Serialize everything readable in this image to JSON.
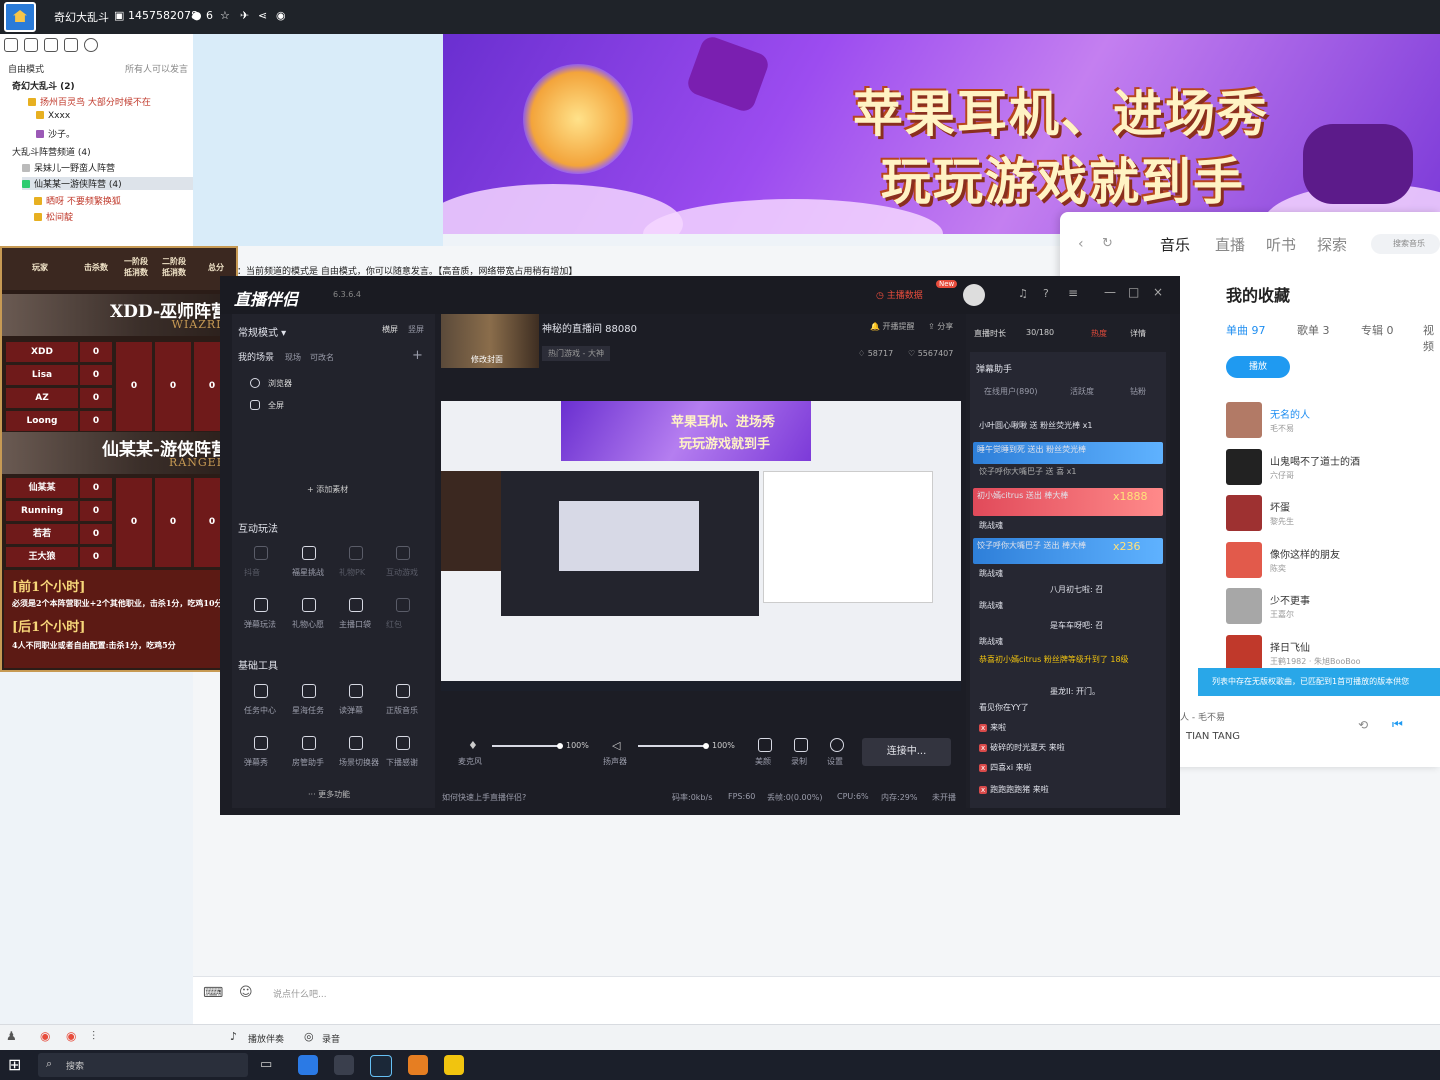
{
  "topbar": {
    "channel_name": "奇幻大乱斗",
    "channel_id": "1457582078",
    "user_count": "6"
  },
  "left_panel": {
    "mode_label": "自由模式",
    "mode_hint": "所有人可以发言",
    "tree": [
      {
        "text": "奇幻大乱斗 (2)"
      },
      {
        "text": "扬州百灵鸟 大部分时候不在"
      },
      {
        "text": "Xxxx"
      },
      {
        "text": "沙子。"
      },
      {
        "text": "大乱斗阵营频道 (4)"
      },
      {
        "text": "呆妹儿一野蛮人阵营"
      },
      {
        "text": "仙某某一游侠阵营 (4)"
      },
      {
        "text": "晒呀 不要频繁换狐"
      },
      {
        "text": "松间靛"
      }
    ]
  },
  "notice": "：当前频道的模式是 自由模式，你可以随意发言。【高音质，网络带宽占用稍有增加】",
  "banner": {
    "line1": "苹果耳机、进场秀",
    "line2": "玩玩游戏就到手"
  },
  "scoreboard": {
    "headers": [
      "玩家",
      "击杀数",
      "一阶段 抵消数",
      "二阶段 抵消数",
      "总分"
    ],
    "team1": {
      "name": "XDD-巫师阵营",
      "sub": "WIAZRD",
      "players": [
        {
          "name": "XDD",
          "kills": "0"
        },
        {
          "name": "Lisa",
          "kills": "0"
        },
        {
          "name": "AZ",
          "kills": "0"
        },
        {
          "name": "Loong",
          "kills": "0"
        }
      ],
      "totals": [
        "0",
        "0",
        "0"
      ]
    },
    "team2": {
      "name": "仙某某-游侠阵营",
      "sub": "RANGER",
      "players": [
        {
          "name": "仙某某",
          "kills": "0"
        },
        {
          "name": "Running",
          "kills": "0"
        },
        {
          "name": "若若",
          "kills": "0"
        },
        {
          "name": "王大狼",
          "kills": "0"
        }
      ],
      "totals": [
        "0",
        "0",
        "0"
      ]
    },
    "rules": {
      "t1": "[前1个小时]",
      "r1": "必须是2个本阵营职业+2个其他职业，击杀1分，吃鸡10分",
      "t2": "[后1个小时]",
      "r2": "4人不同职业或者自由配置:击杀1分，吃鸡5分"
    }
  },
  "app": {
    "logo": "直播伴侣",
    "version": "6.3.6.4",
    "live_data": "主播数据",
    "new_badge": "New",
    "mode": "常规模式",
    "orientation": [
      "横屏",
      "竖屏"
    ],
    "scene_label": "我的场景",
    "scene_tabs": [
      "现场",
      "可改名"
    ],
    "sources": [
      "浏览器",
      "全屏"
    ],
    "add_material": "+ 添加素材",
    "interactive": "互动玩法",
    "interactive_items": [
      "抖音",
      "福星挑战",
      "礼物PK",
      "互动游戏",
      "弹幕玩法",
      "礼物心愿",
      "主播口袋",
      "红包"
    ],
    "tools": "基础工具",
    "tools_items": [
      "任务中心",
      "星海任务",
      "读弹幕",
      "正版音乐",
      "弹幕秀",
      "房管助手",
      "场景切换器",
      "下播感谢"
    ],
    "more": "··· 更多功能",
    "room_title": "神秘的直播间 88080",
    "category": "热门游戏 - 大神",
    "cover_label": "修改封面",
    "open_remind": "开播提醒",
    "share": "分享",
    "fans": "58717",
    "likes": "5567407",
    "duration_label": "直播时长",
    "duration_value": "30/180",
    "heat": "热度",
    "details": "详情",
    "mic_label": "麦克风",
    "mic_pct": "100%",
    "spk_label": "扬声器",
    "spk_pct": "100%",
    "beauty": "美颜",
    "record": "录制",
    "settings": "设置",
    "connect": "连接中...",
    "hint": "如何快速上手直播伴侣?",
    "stats": [
      "码率:0kb/s",
      "FPS:60",
      "丢帧:0(0.00%)",
      "CPU:6%",
      "内存:29%",
      "未开播"
    ],
    "danmu_title": "弹幕助手",
    "danmu_tabs": [
      "在线用户(890)",
      "活跃度",
      "钻粉"
    ],
    "chat": [
      "小叶圆心啾啾 送 粉丝荧光棒 x1",
      "睡午觉睡到死 送出 粉丝荧光棒",
      "饺子呼你大嘴巴子 送 喜 x1",
      "初小嫣citrus 送出 棒大棒",
      "x1888",
      "跳战魂",
      "饺子呼你大嘴巴子 送出 棒大棒",
      "x236",
      "跳战魂",
      "八月初七啦: 召",
      "跳战魂",
      "是车车呀吧: 召",
      "跳战魂",
      "恭喜初小嫣citrus 粉丝牌等级升到了 18级",
      "墨龙II: 开门。",
      "看见你在YY了",
      "来啦",
      "破碎的时光夏天 来啦",
      "四喜xi 来啦",
      "跑跑跑跑猪 来啦"
    ]
  },
  "music": {
    "tabs": [
      "音乐",
      "直播",
      "听书",
      "探索"
    ],
    "search": "搜索音乐",
    "title": "我的收藏",
    "sub_tabs": [
      "单曲 97",
      "歌单 3",
      "专辑 0",
      "视频"
    ],
    "play": "播放",
    "songs": [
      {
        "title": "无名的人",
        "artist": "毛不易"
      },
      {
        "title": "山鬼喝不了道士的酒",
        "artist": "六仔哥"
      },
      {
        "title": "坏蛋",
        "artist": "黎先生"
      },
      {
        "title": "像你这样的朋友",
        "artist": "陈奕"
      },
      {
        "title": "少不更事",
        "artist": "王嘉尔"
      },
      {
        "title": "择日飞仙",
        "artist": "王鹤1982 · 朱旭BooBoo"
      }
    ],
    "copyright_tip": "列表中存在无版权歌曲，已匹配到1首可播放的版本供您",
    "now_playing": "人 - 毛不易",
    "footer": "TIAN TANG"
  },
  "input": {
    "placeholder": "说点什么吧..."
  },
  "bottom": {
    "items": [
      "播放伴奏",
      "录音"
    ]
  },
  "taskbar": {
    "search": "搜索"
  }
}
